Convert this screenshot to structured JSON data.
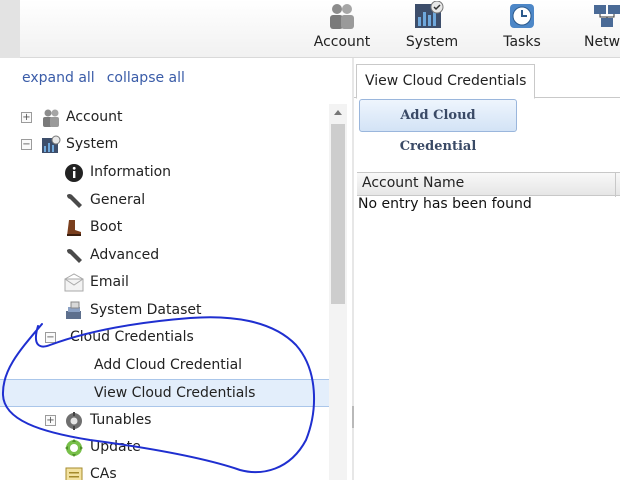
{
  "toolbar": {
    "items": [
      {
        "label": "Account",
        "icon": "account-icon"
      },
      {
        "label": "System",
        "icon": "system-icon"
      },
      {
        "label": "Tasks",
        "icon": "tasks-icon"
      },
      {
        "label": "Network",
        "icon": "network-icon"
      }
    ]
  },
  "tree_controls": {
    "expand_all": "expand all",
    "collapse_all": "collapse all"
  },
  "tree": {
    "account": "Account",
    "system": "System",
    "information": "Information",
    "general": "General",
    "boot": "Boot",
    "advanced": "Advanced",
    "email": "Email",
    "system_dataset": "System Dataset",
    "cloud_credentials": "Cloud Credentials",
    "add_cloud_credential": "Add Cloud Credential",
    "view_cloud_credentials": "View Cloud Credentials",
    "tunables": "Tunables",
    "update": "Update",
    "cas": "CAs"
  },
  "main": {
    "tab_label": "View Cloud Credentials",
    "add_button": "Add Cloud Credential",
    "grid": {
      "columns": [
        "Account Name"
      ],
      "empty_text": "No entry has been found"
    }
  },
  "colors": {
    "link": "#3a5ca8",
    "selection": "#e3eefb",
    "annotation": "#1f2fd0"
  }
}
